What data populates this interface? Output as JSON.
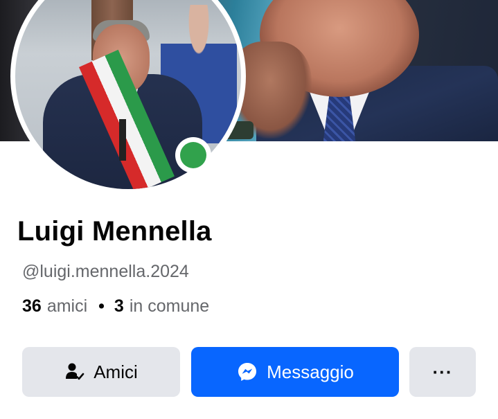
{
  "profile": {
    "name": "Luigi Mennella",
    "username": "@luigi.mennella.2024",
    "friends_count": "36",
    "friends_label": "amici",
    "separator": "•",
    "mutual_count": "3",
    "mutual_label": "in comune",
    "online_status_color": "#31a24c"
  },
  "actions": {
    "friends_label": "Amici",
    "friends_icon": "person-check-icon",
    "message_label": "Messaggio",
    "message_icon": "messenger-icon",
    "more_icon": "more-dots-icon",
    "more_label": "···"
  },
  "colors": {
    "primary": "#0866ff",
    "secondary_button": "#e4e6eb",
    "text_primary": "#050505",
    "text_secondary": "#65676b"
  }
}
